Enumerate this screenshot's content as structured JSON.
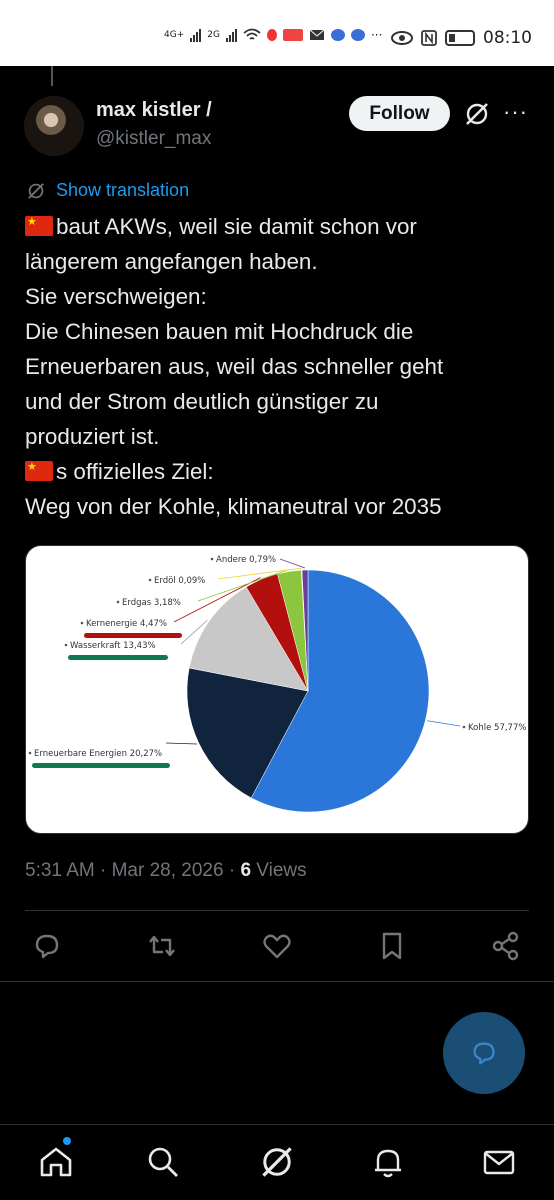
{
  "status_bar": {
    "network_1": "4G+",
    "network_2": "2G",
    "time": "08:10"
  },
  "tweet": {
    "author_name": "max kistler /",
    "author_handle": "@kistler_max",
    "follow_label": "Follow",
    "show_translation": "Show translation",
    "lines": [
      "baut AKWs, weil sie damit schon vor",
      "längerem angefangen haben.",
      "Sie verschweigen:",
      "Die Chinesen bauen mit Hochdruck die",
      "Erneuerbaren aus, weil das schneller geht",
      "und der Strom deutlich günstiger zu",
      "produziert ist.",
      "s offizielles Ziel:",
      "Weg von der Kohle, klimaneutral vor 2035"
    ],
    "timestamp": "5:31 AM · Mar 28, 2026 · ",
    "views_count": "6",
    "views_label": " Views"
  },
  "chart_data": {
    "type": "pie",
    "title": "",
    "slices": [
      {
        "label": "Kohle",
        "value": 57.77,
        "display": "Kohle 57,77%",
        "color": "#2b77d9"
      },
      {
        "label": "Erneuerbare Energien",
        "value": 20.27,
        "display": "Erneuerbare Energien 20,27%",
        "color": "#10243d"
      },
      {
        "label": "Wasserkraft",
        "value": 13.43,
        "display": "Wasserkraft 13,43%",
        "color": "#c8c8c8"
      },
      {
        "label": "Kernenergie",
        "value": 4.47,
        "display": "Kernenergie 4,47%",
        "color": "#b30f0f"
      },
      {
        "label": "Erdgas",
        "value": 3.18,
        "display": "Erdgas 3,18%",
        "color": "#8cc63f"
      },
      {
        "label": "Erdöl",
        "value": 0.09,
        "display": "Erdöl 0,09%",
        "color": "#f0d43a"
      },
      {
        "label": "Andere",
        "value": 0.79,
        "display": "Andere 0,79%",
        "color": "#6a3d9a"
      }
    ],
    "underlined": {
      "Kernenergie": "#b30f0f",
      "Wasserkraft": "#0e7a4f",
      "Erneuerbare Energien": "#0e7a4f"
    }
  }
}
